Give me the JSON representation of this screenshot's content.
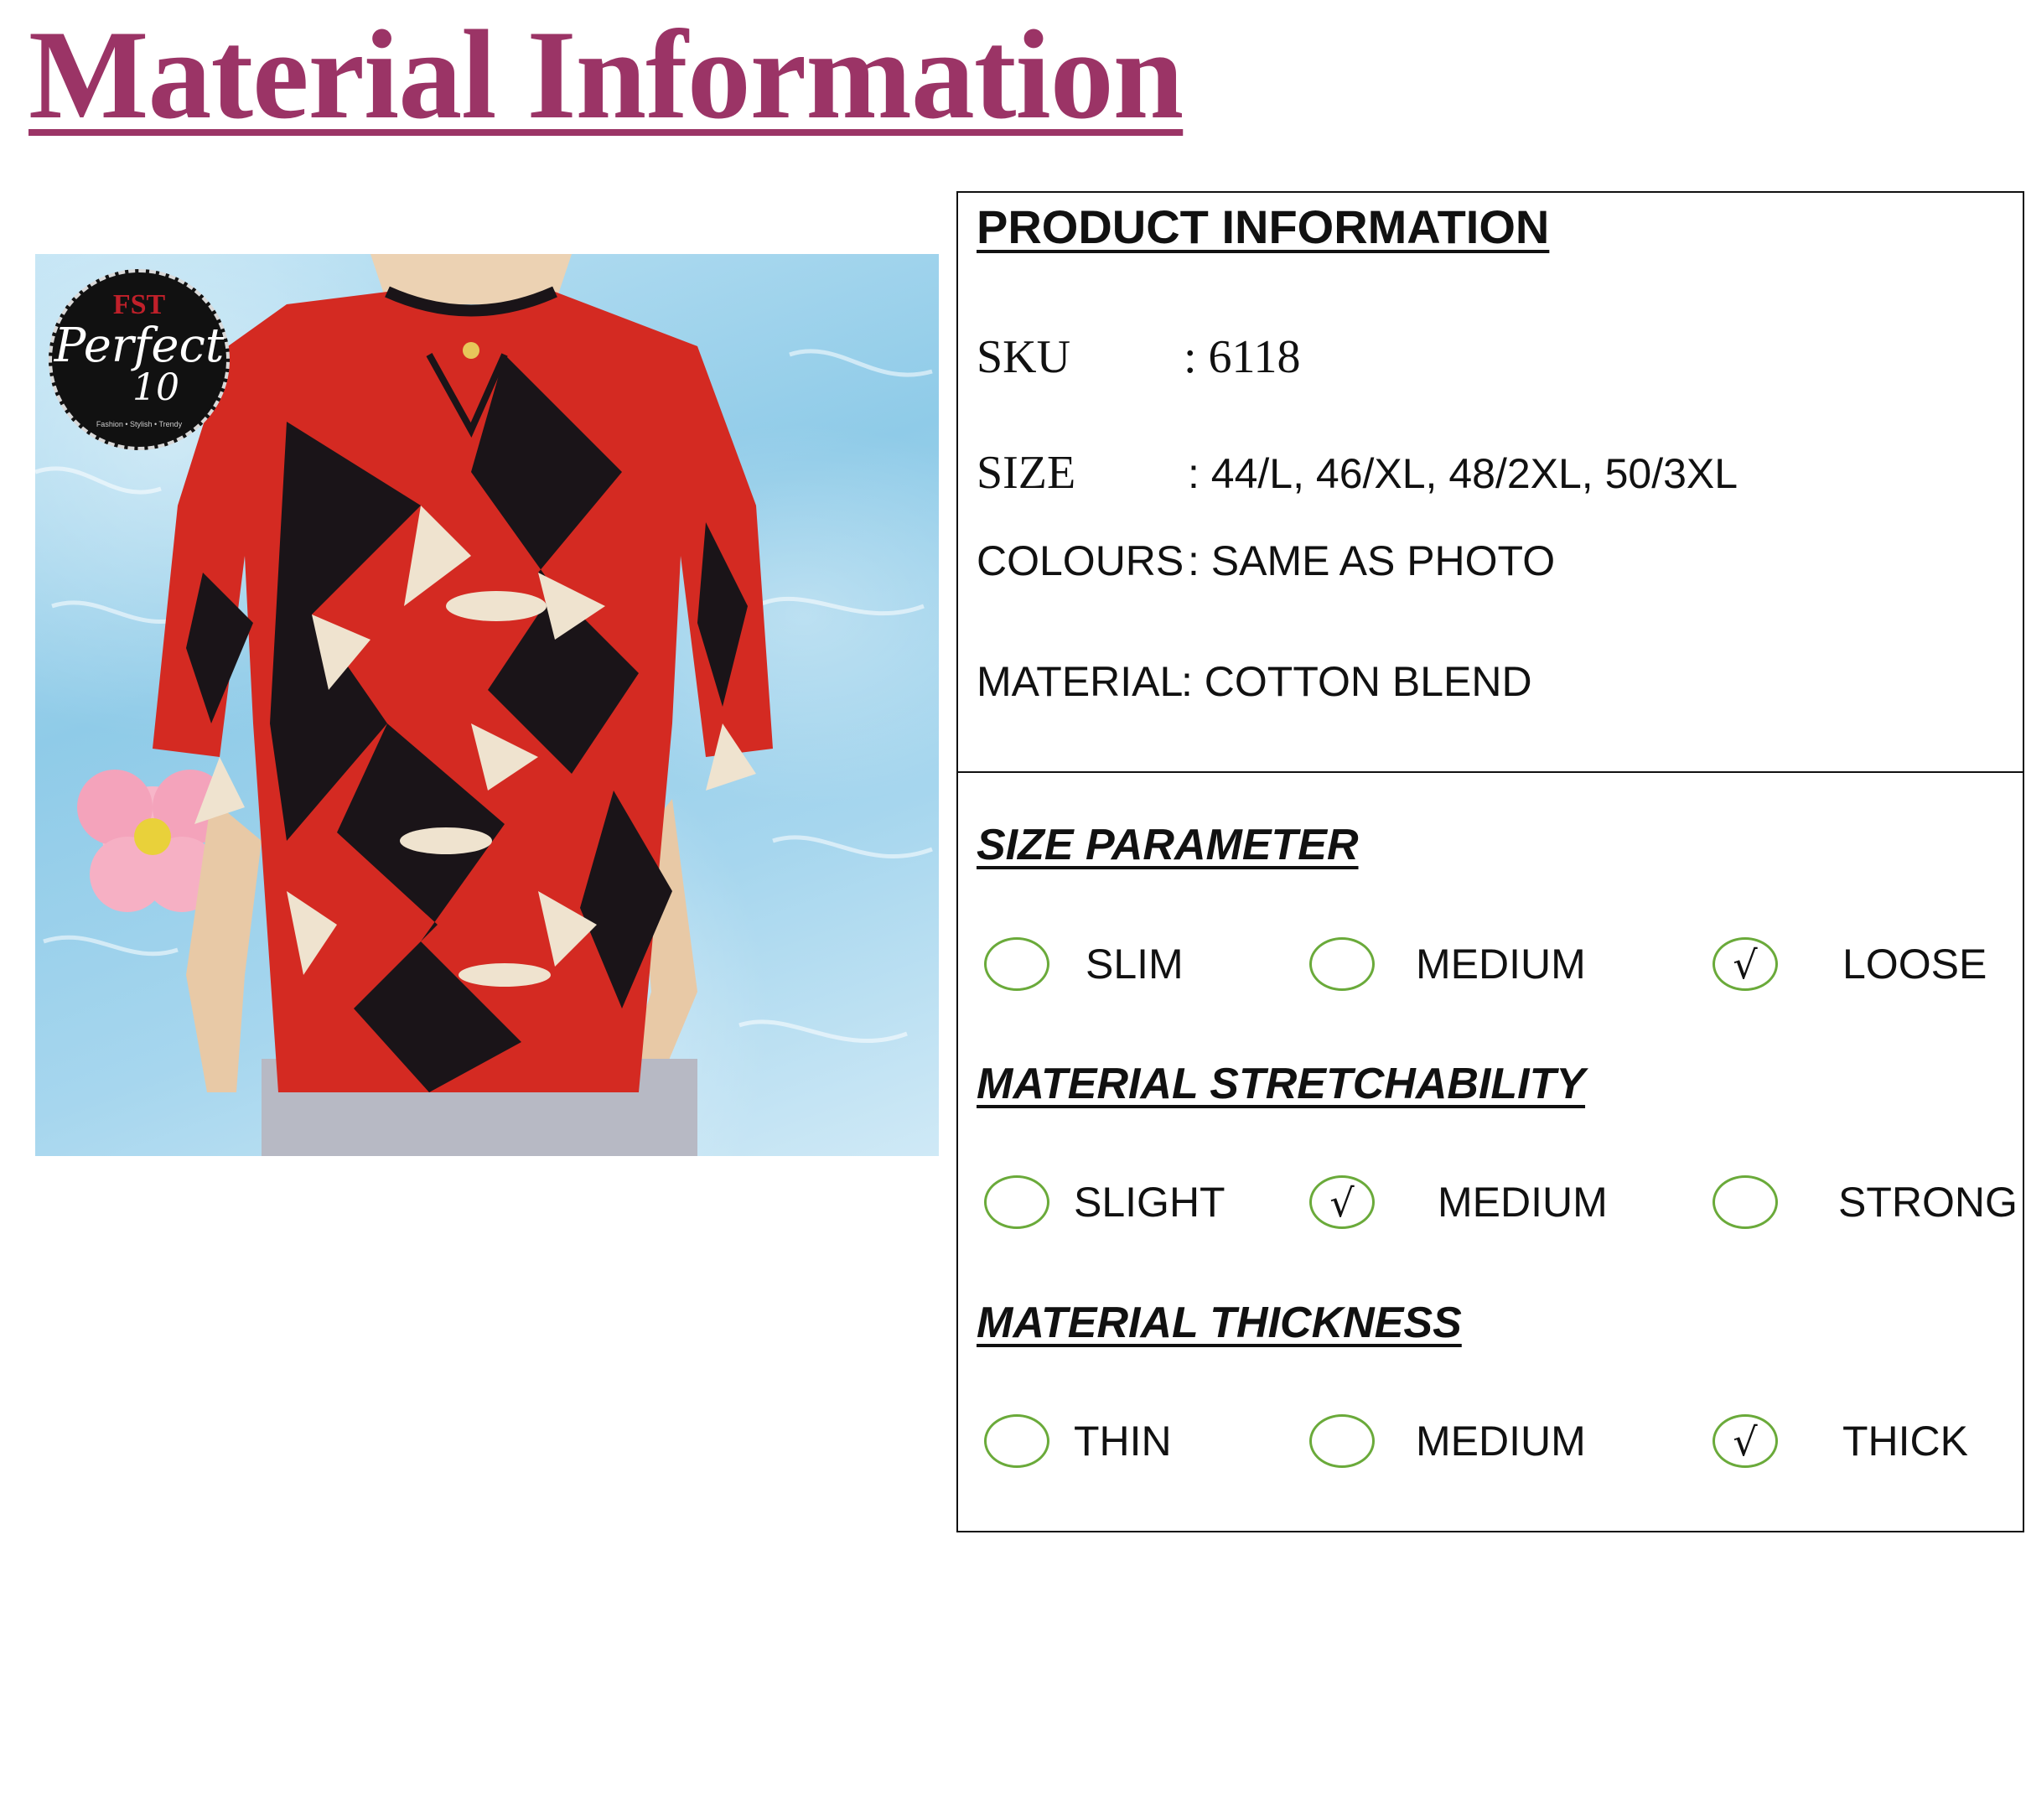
{
  "page": {
    "title": "Material Information"
  },
  "brand": {
    "top": "FST",
    "main": "Perfect",
    "number": "10",
    "tagline": "Fashion • Stylish • Trendy"
  },
  "product_info": {
    "heading": "PRODUCT INFORMATION",
    "sku": {
      "label": "SKU",
      "value": ": 6118"
    },
    "size": {
      "label": "SIZE",
      "value": ": 44/L, 46/XL, 48/2XL, 50/3XL"
    },
    "colours": {
      "label": "COLOURS",
      "value": ": SAME AS PHOTO"
    },
    "material": {
      "label": "MATERIAL",
      "value": ": COTTON BLEND"
    }
  },
  "size_parameter": {
    "heading": "SIZE PARAMETER",
    "options": [
      {
        "label": "SLIM",
        "checked": false,
        "mark": ""
      },
      {
        "label": "MEDIUM",
        "checked": false,
        "mark": ""
      },
      {
        "label": "LOOSE",
        "checked": true,
        "mark": "√"
      }
    ]
  },
  "stretchability": {
    "heading": "MATERIAL STRETCHABILITY",
    "options": [
      {
        "label": "SLIGHT",
        "checked": false,
        "mark": ""
      },
      {
        "label": "MEDIUM",
        "checked": true,
        "mark": "√"
      },
      {
        "label": "STRONG",
        "checked": false,
        "mark": ""
      }
    ]
  },
  "thickness": {
    "heading": "MATERIAL THICKNESS",
    "options": [
      {
        "label": "THIN",
        "checked": false,
        "mark": ""
      },
      {
        "label": "MEDIUM",
        "checked": false,
        "mark": ""
      },
      {
        "label": "THICK",
        "checked": true,
        "mark": "√"
      }
    ]
  },
  "colors": {
    "title": "#9b3466",
    "circle": "#6aaa3a",
    "top_red": "#d42a22",
    "top_dark": "#1a1418",
    "top_cream": "#efe3cf"
  }
}
